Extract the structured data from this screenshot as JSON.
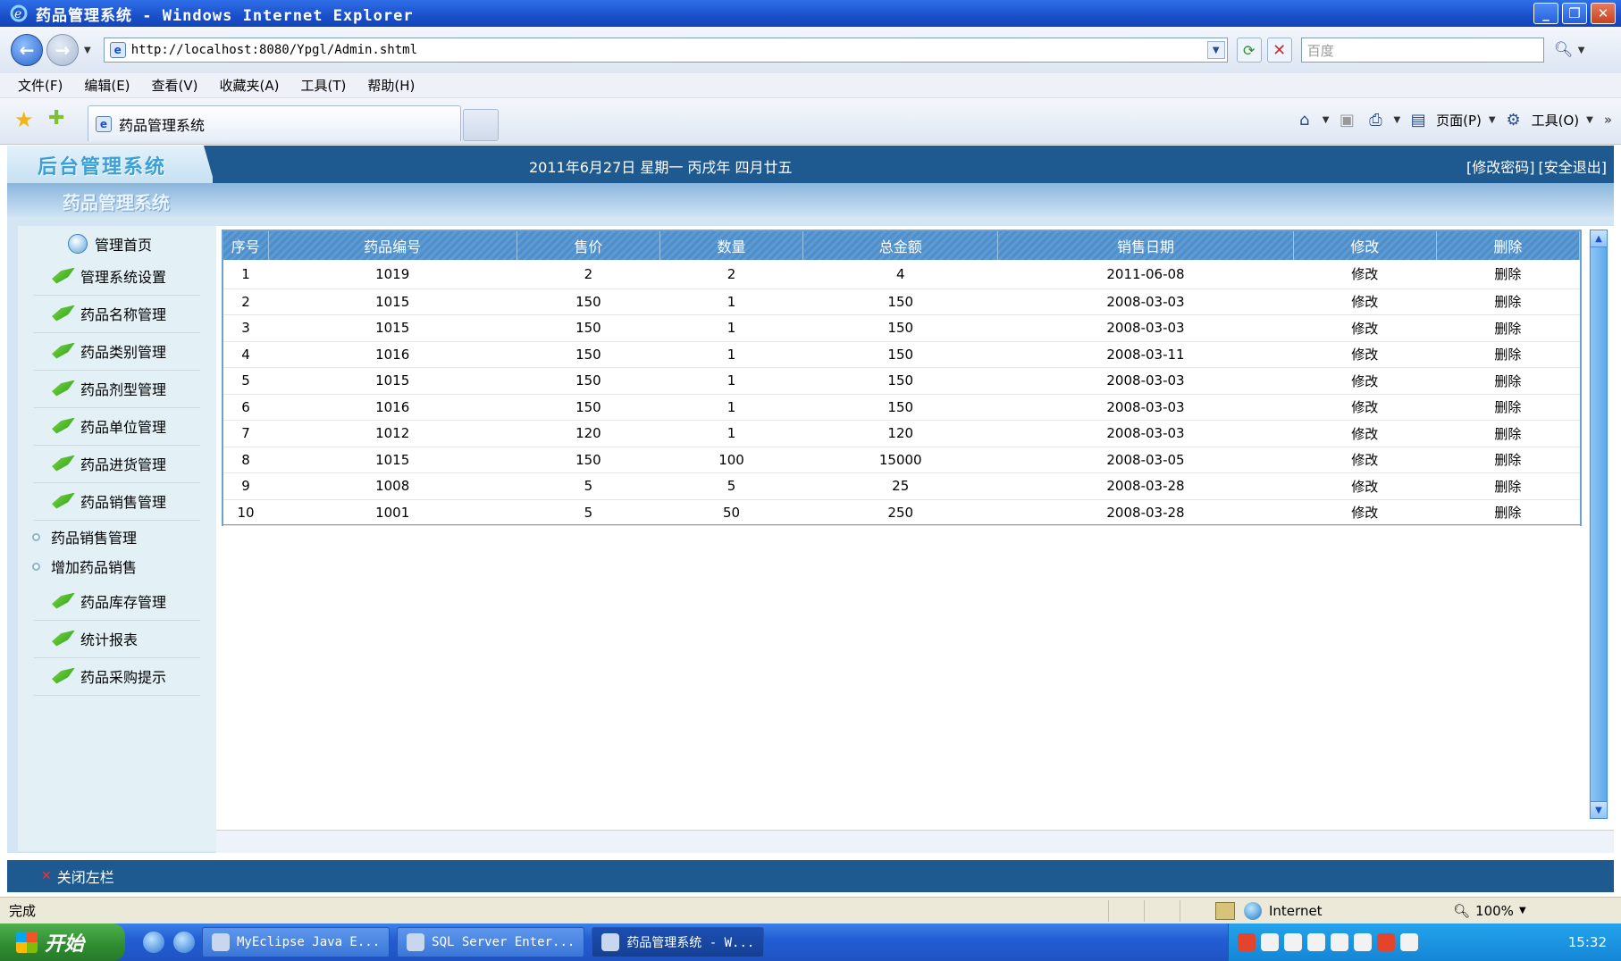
{
  "window": {
    "title": "药品管理系统 - Windows Internet Explorer"
  },
  "browser": {
    "url": "http://localhost:8080/Ypgl/Admin.shtml",
    "search_placeholder": "百度",
    "menu": [
      "文件(F)",
      "编辑(E)",
      "查看(V)",
      "收藏夹(A)",
      "工具(T)",
      "帮助(H)"
    ],
    "tab_title": "药品管理系统",
    "page_label": "页面(P)",
    "tools_label": "工具(O)"
  },
  "header": {
    "logo": "后台管理系统",
    "date": "2011年6月27日 星期一 丙戌年 四月廿五",
    "change_password": "[修改密码]",
    "logout": "[安全退出]",
    "subtitle": "药品管理系统"
  },
  "sidebar": {
    "home": "管理首页",
    "items": [
      "管理系统设置",
      "药品名称管理",
      "药品类别管理",
      "药品剂型管理",
      "药品单位管理",
      "药品进货管理",
      "药品销售管理"
    ],
    "subitems": [
      "药品销售管理",
      "增加药品销售"
    ],
    "items_after": [
      "药品库存管理",
      "统计报表",
      "药品采购提示"
    ],
    "close_label": "关闭左栏"
  },
  "table": {
    "headers": [
      "序号",
      "药品编号",
      "售价",
      "数量",
      "总金额",
      "销售日期",
      "修改",
      "删除"
    ],
    "rows": [
      [
        "1",
        "1019",
        "2",
        "2",
        "4",
        "2011-06-08",
        "修改",
        "删除"
      ],
      [
        "2",
        "1015",
        "150",
        "1",
        "150",
        "2008-03-03",
        "修改",
        "删除"
      ],
      [
        "3",
        "1015",
        "150",
        "1",
        "150",
        "2008-03-03",
        "修改",
        "删除"
      ],
      [
        "4",
        "1016",
        "150",
        "1",
        "150",
        "2008-03-11",
        "修改",
        "删除"
      ],
      [
        "5",
        "1015",
        "150",
        "1",
        "150",
        "2008-03-03",
        "修改",
        "删除"
      ],
      [
        "6",
        "1016",
        "150",
        "1",
        "150",
        "2008-03-03",
        "修改",
        "删除"
      ],
      [
        "7",
        "1012",
        "120",
        "1",
        "120",
        "2008-03-03",
        "修改",
        "删除"
      ],
      [
        "8",
        "1015",
        "150",
        "100",
        "15000",
        "2008-03-05",
        "修改",
        "删除"
      ],
      [
        "9",
        "1008",
        "5",
        "5",
        "25",
        "2008-03-28",
        "修改",
        "删除"
      ],
      [
        "10",
        "1001",
        "5",
        "50",
        "250",
        "2008-03-28",
        "修改",
        "删除"
      ]
    ]
  },
  "status": {
    "text": "完成",
    "zone": "Internet",
    "zoom": "100%"
  },
  "taskbar": {
    "start": "开始",
    "tasks": [
      "MyEclipse Java E...",
      "SQL Server Enter...",
      "药品管理系统 - W..."
    ],
    "clock": "15:32"
  }
}
